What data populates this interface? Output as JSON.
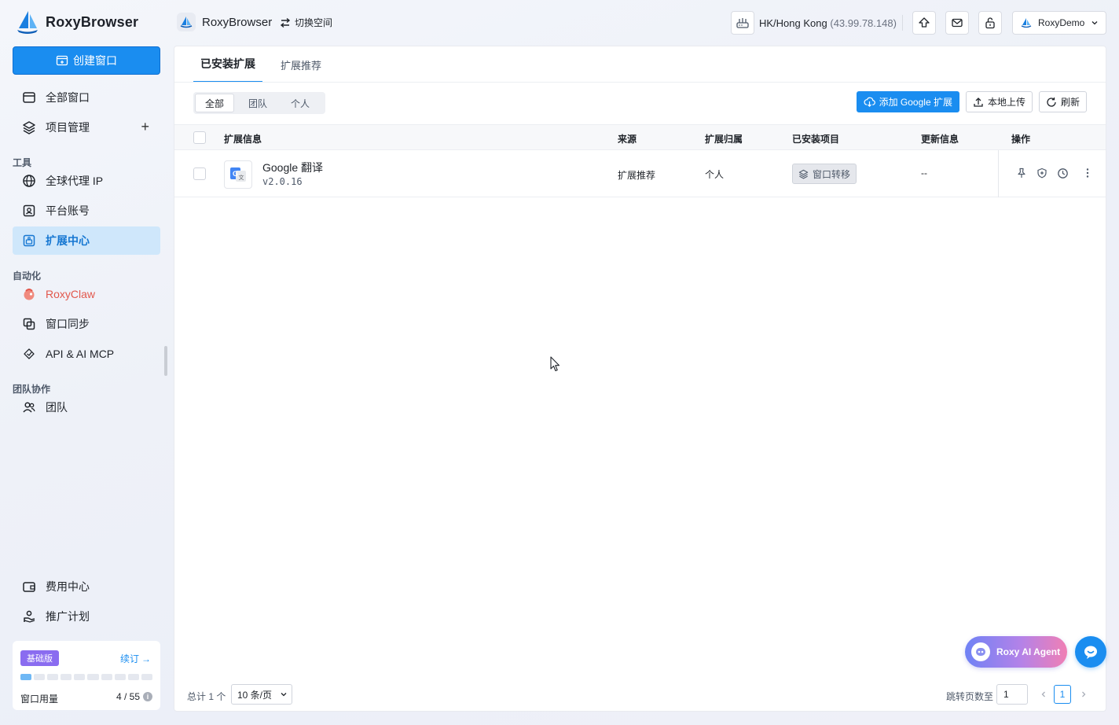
{
  "app": {
    "name": "RoxyBrowser"
  },
  "sidebar": {
    "create_label": "创建窗口",
    "items": [
      {
        "label": "全部窗口",
        "icon": "window-icon"
      },
      {
        "label": "项目管理",
        "icon": "layers-icon"
      }
    ],
    "sections": {
      "tools": "工具",
      "automation": "自动化",
      "team": "团队协作"
    },
    "tools": [
      {
        "label": "全球代理 IP",
        "icon": "globe-icon"
      },
      {
        "label": "平台账号",
        "icon": "account-icon"
      },
      {
        "label": "扩展中心",
        "icon": "extension-icon",
        "active": true
      }
    ],
    "automation": [
      {
        "label": "RoxyClaw",
        "icon": "roxyclaw-icon"
      },
      {
        "label": "窗口同步",
        "icon": "sync-windows-icon"
      },
      {
        "label": "API & AI MCP",
        "icon": "api-icon"
      }
    ],
    "team": [
      {
        "label": "团队",
        "icon": "team-icon"
      }
    ],
    "bottom": [
      {
        "label": "费用中心",
        "icon": "wallet-icon"
      },
      {
        "label": "推广计划",
        "icon": "referral-icon"
      }
    ],
    "plan": {
      "badge": "基础版",
      "renew": "续订",
      "usage_label": "窗口用量",
      "usage_value": "4 / 55",
      "usage_fraction": 0.0727
    }
  },
  "topbar": {
    "brand": "RoxyBrowser",
    "switch_space": "切换空间",
    "proxy_location": "HK/Hong Kong",
    "proxy_ip": "(43.99.78.148)",
    "user": "RoxyDemo"
  },
  "main": {
    "tabs": [
      {
        "label": "已安装扩展",
        "active": true
      },
      {
        "label": "扩展推荐",
        "active": false
      }
    ],
    "filters": [
      "全部",
      "团队",
      "个人"
    ],
    "actions": {
      "add_google": "添加 Google 扩展",
      "local_upload": "本地上传",
      "refresh": "刷新"
    },
    "table": {
      "headers": [
        "扩展信息",
        "来源",
        "扩展归属",
        "已安装项目",
        "更新信息",
        "操作"
      ],
      "rows": [
        {
          "name": "Google 翻译",
          "version": "v2.0.16",
          "source": "扩展推荐",
          "owner": "个人",
          "installed": "窗口转移",
          "update": "--"
        }
      ]
    },
    "footer": {
      "total": "总计 1 个",
      "page_size": "10 条/页",
      "jump_label": "跳转页数至",
      "jump_value": "1",
      "current_page": "1"
    }
  },
  "floating": {
    "agent": "Roxy AI Agent"
  },
  "colors": {
    "accent": "#1a8df0",
    "active_nav_bg": "#cfe7fb",
    "plan_badge": "#8a6cf0",
    "roxyclaw": "#e2574c"
  }
}
